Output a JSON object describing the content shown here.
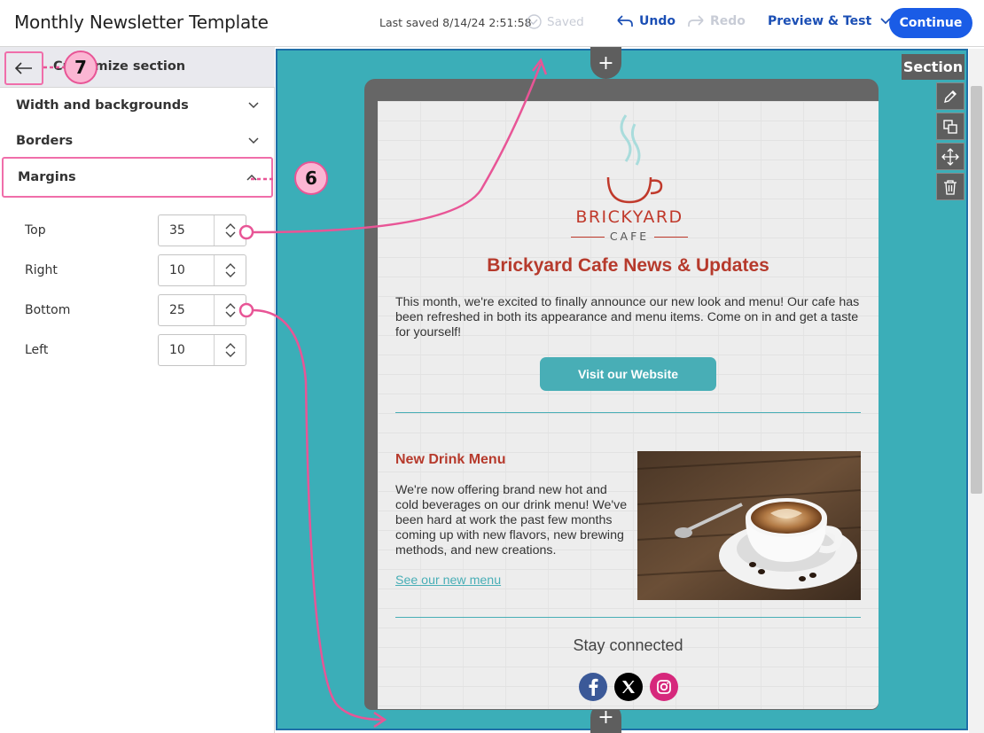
{
  "header": {
    "title": "Monthly Newsletter Template",
    "last_saved": "Last saved 8/14/24 2:51:58",
    "saved_label": "Saved",
    "undo_label": "Undo",
    "redo_label": "Redo",
    "preview_label": "Preview & Test",
    "continue_label": "Continue"
  },
  "panel": {
    "title": "Customize section",
    "sections": [
      {
        "label": "Width and backgrounds",
        "expanded": false
      },
      {
        "label": "Borders",
        "expanded": false
      },
      {
        "label": "Margins",
        "expanded": true
      }
    ],
    "margins": [
      {
        "label": "Top",
        "value": "35"
      },
      {
        "label": "Right",
        "value": "10"
      },
      {
        "label": "Bottom",
        "value": "25"
      },
      {
        "label": "Left",
        "value": "10"
      }
    ]
  },
  "canvas": {
    "section_label": "Section",
    "plus": "+",
    "section_bg_color": "#3baeb8"
  },
  "email": {
    "logo_top": "BRICKYARD",
    "logo_bottom": "CAFE",
    "headline": "Brickyard Cafe News & Updates",
    "intro": "This month, we're excited to finally announce our new look and menu! Our cafe has been refreshed in both its appearance and menu items. Come on in and get a taste for yourself!",
    "visit_button": "Visit our Website",
    "drink_title": "New Drink Menu",
    "drink_body": "We're now offering brand new hot and cold beverages on our drink menu! We've been hard at work the past few months coming up with new flavors, new brewing methods, and new creations.",
    "drink_link": "See our new menu",
    "stay_connected": "Stay connected",
    "social": [
      "facebook-icon",
      "x-icon",
      "instagram-icon"
    ]
  },
  "callouts": {
    "back": "7",
    "margins": "6"
  },
  "colors": {
    "accent": "#1a5ce6",
    "highlight": "#f06eaa",
    "headline": "#b63a2c",
    "teal": "#48aeb6"
  }
}
